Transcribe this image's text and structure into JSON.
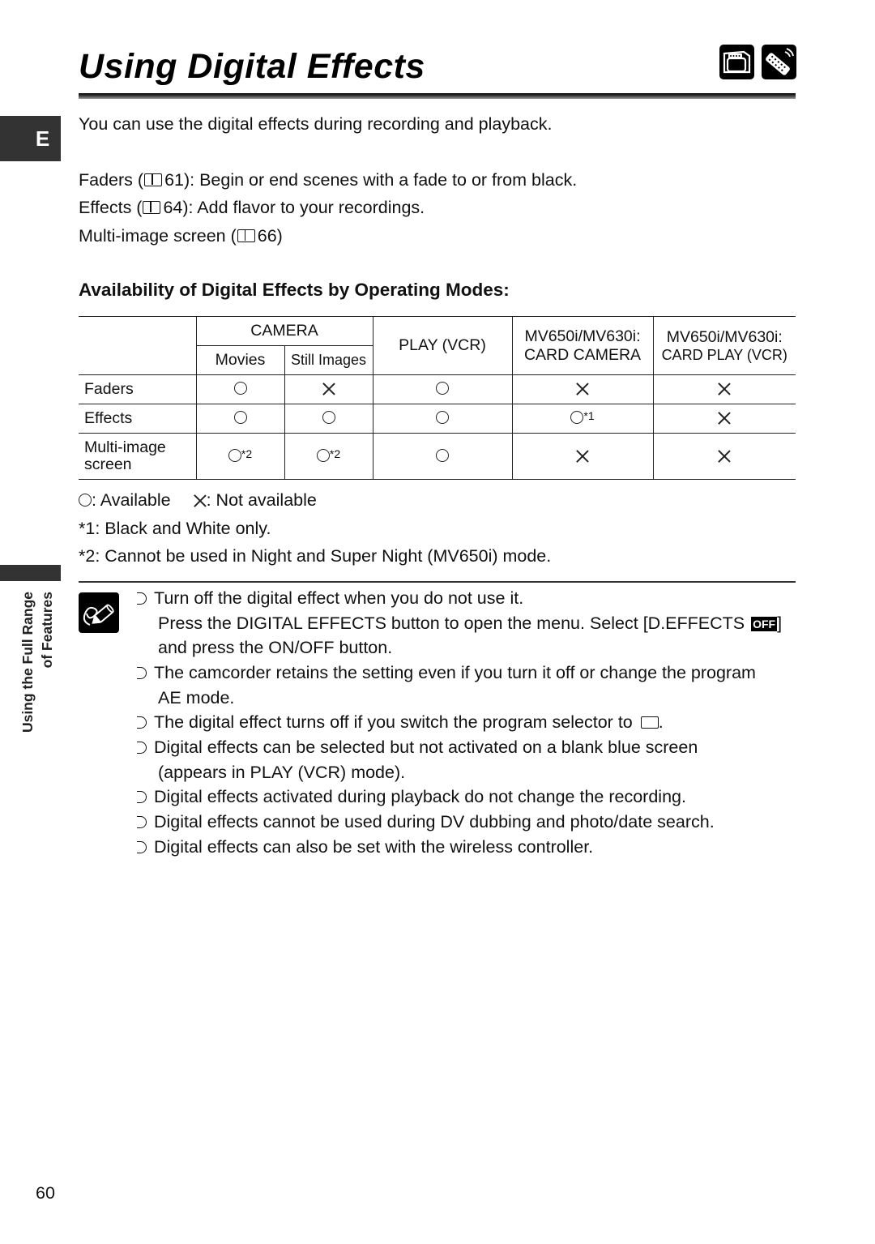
{
  "header": {
    "title": "Using Digital Effects",
    "mode_icons": [
      "camera-mode-icon",
      "wireless-remote-icon"
    ]
  },
  "language_tab": "E",
  "intro": "You can use the digital effects during recording and playback.",
  "references": [
    {
      "label": "Faders (",
      "page": "61",
      "suffix": "): Begin or end scenes with a fade to or from black."
    },
    {
      "label": "Effects (",
      "page": "64",
      "suffix": "): Add flavor to your recordings."
    },
    {
      "label": "Multi-image screen (",
      "page": "66",
      "suffix": ")"
    }
  ],
  "table_heading": "Availability of Digital Effects by Operating Modes:",
  "table": {
    "headers": {
      "camera": "CAMERA",
      "movies": "Movies",
      "still_images": "Still Images",
      "play_vcr": "PLAY (VCR)",
      "card_camera_line1": "MV650i/MV630i:",
      "card_camera_line2": "CARD CAMERA",
      "card_play_line1": "MV650i/MV630i:",
      "card_play_line2": "CARD PLAY (VCR)"
    },
    "rows": [
      {
        "label": "Faders",
        "cells": [
          {
            "v": "available",
            "note": ""
          },
          {
            "v": "not-available",
            "note": ""
          },
          {
            "v": "available",
            "note": ""
          },
          {
            "v": "not-available",
            "note": ""
          },
          {
            "v": "not-available",
            "note": ""
          }
        ]
      },
      {
        "label": "Effects",
        "cells": [
          {
            "v": "available",
            "note": ""
          },
          {
            "v": "available",
            "note": ""
          },
          {
            "v": "available",
            "note": ""
          },
          {
            "v": "available",
            "note": "*1"
          },
          {
            "v": "not-available",
            "note": ""
          }
        ]
      },
      {
        "label_line1": "Multi-image",
        "label_line2": "screen",
        "cells": [
          {
            "v": "available",
            "note": "*2"
          },
          {
            "v": "available",
            "note": "*2"
          },
          {
            "v": "available",
            "note": ""
          },
          {
            "v": "not-available",
            "note": ""
          },
          {
            "v": "not-available",
            "note": ""
          }
        ]
      }
    ]
  },
  "legend": {
    "available": ": Available",
    "not_available": ": Not available"
  },
  "footnotes": [
    "*1: Black and White only.",
    "*2: Cannot be used in Night and Super Night (MV650i) mode."
  ],
  "side_label": {
    "line1": "Using the Full Range",
    "line2": "of Features"
  },
  "tips": {
    "t1": "Turn off the digital effect when you do not use it.",
    "t1_cont1_a": "Press the DIGITAL EFFECTS button to open the menu. Select [D.EFFECTS ",
    "t1_badge": "OFF",
    "t1_cont1_b": "]",
    "t1_cont2": "and press the ON/OFF button.",
    "t2": "The camcorder retains the setting even if you turn it off or change the program",
    "t2_cont": "AE mode.",
    "t3": "The digital effect turns off if you switch the program selector to ",
    "t3_end": ".",
    "t4": "Digital effects can be selected but not activated on a blank blue screen",
    "t4_cont": "(appears in PLAY (VCR) mode).",
    "t5": "Digital effects activated during playback do not change the recording.",
    "t6": "Digital effects cannot be used during DV dubbing and photo/date search.",
    "t7": "Digital effects can also be set with the wireless controller."
  },
  "page_number": "60"
}
